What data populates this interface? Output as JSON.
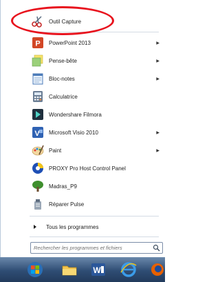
{
  "start_menu": {
    "items": [
      {
        "label": "Outil Capture",
        "icon": "scissors-icon",
        "has_submenu": false
      },
      {
        "label": "PowerPoint 2013",
        "icon": "powerpoint-icon",
        "has_submenu": true
      },
      {
        "label": "Pense-bête",
        "icon": "sticky-notes-icon",
        "has_submenu": true
      },
      {
        "label": "Bloc-notes",
        "icon": "notepad-icon",
        "has_submenu": true
      },
      {
        "label": "Calculatrice",
        "icon": "calculator-icon",
        "has_submenu": false
      },
      {
        "label": "Wondershare Filmora",
        "icon": "filmora-icon",
        "has_submenu": false
      },
      {
        "label": "Microsoft Visio 2010",
        "icon": "visio-icon",
        "has_submenu": true
      },
      {
        "label": "Paint",
        "icon": "paint-icon",
        "has_submenu": true
      },
      {
        "label": "PROXY Pro Host Control Panel",
        "icon": "proxy-icon",
        "has_submenu": false
      },
      {
        "label": "Madras_P9",
        "icon": "tree-icon",
        "has_submenu": false
      },
      {
        "label": "Réparer Pulse",
        "icon": "repair-icon",
        "has_submenu": false
      }
    ],
    "all_programs": "Tous les programmes",
    "search_placeholder": "Rechercher les programmes et fichiers"
  },
  "taskbar": {
    "buttons": [
      "start-orb-icon",
      "explorer-icon",
      "word-icon",
      "internet-explorer-icon",
      "firefox-icon"
    ]
  },
  "colors": {
    "callout": "#e8121d",
    "taskbar": "#2f4d74"
  }
}
